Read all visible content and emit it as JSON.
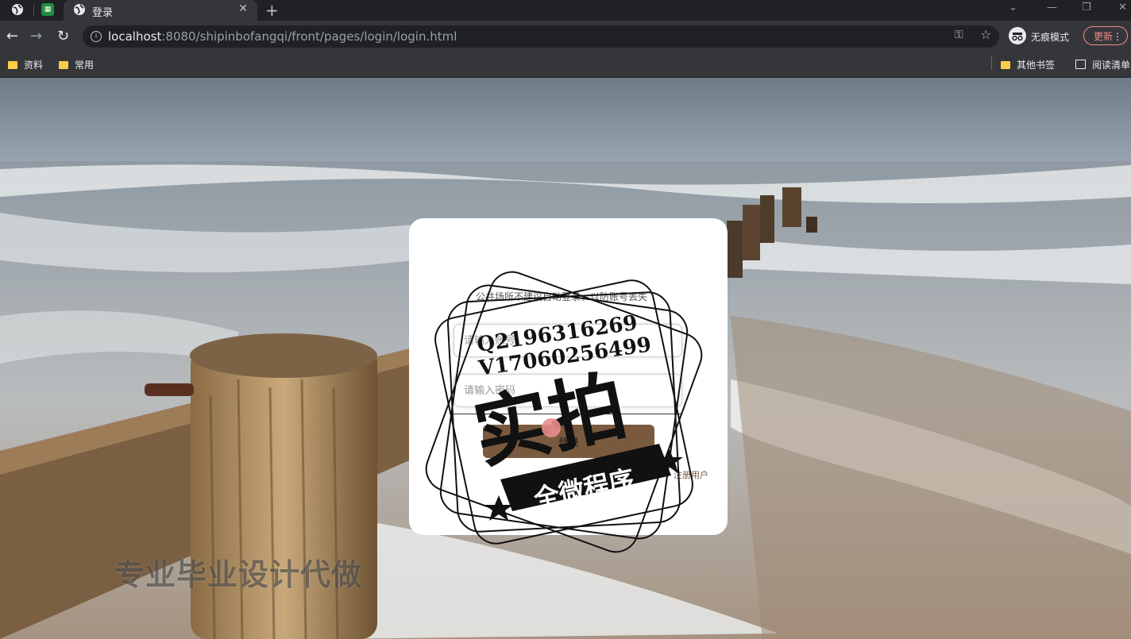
{
  "browser": {
    "tab_title": "登录",
    "url_host": "localhost",
    "url_path": ":8080/shipinbofangqi/front/pages/login/login.html",
    "incognito_label": "无痕模式",
    "update_label": "更新",
    "bookmarks": [
      "资料",
      "常用"
    ],
    "other_bookmarks": "其他书签",
    "reading_list": "阅读清单"
  },
  "login": {
    "notice": "公共场所不建议自动登录，以防账号丢失",
    "username_placeholder": "请输入账号",
    "password_placeholder": "请输入密码",
    "login_label": "登录",
    "register_label": "注册用户"
  },
  "watermark": {
    "contact_q": "Q2196316269",
    "contact_v": "V17060256499",
    "main": "实拍",
    "banner": "全微程序",
    "bottom": "专业毕业设计代做"
  },
  "colors": {
    "brown_accent": "#7a5a3e",
    "chrome_dark": "#202124",
    "chrome_toolbar": "#35363a"
  }
}
